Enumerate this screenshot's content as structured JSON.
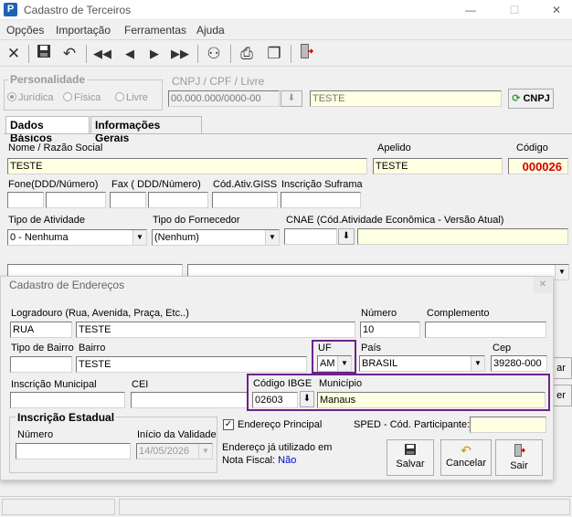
{
  "window": {
    "title": "Cadastro de Terceiros",
    "app_icon": "P",
    "minimize": "—",
    "maximize": "☐",
    "close": "✕"
  },
  "menu": [
    "Opções",
    "Importação",
    "Ferramentas",
    "Ajuda"
  ],
  "toolbar_icons": [
    "close-x-icon",
    "save-icon",
    "undo-icon",
    "first-record-icon",
    "previous-record-icon",
    "next-record-icon",
    "last-record-icon",
    "users-icon",
    "print-icon",
    "copy-icon",
    "exit-door-icon"
  ],
  "personalidade": {
    "title": "Personalidade",
    "options": [
      "Jurídica",
      "Física",
      "Livre"
    ],
    "selected": "Jurídica"
  },
  "cnpj": {
    "label": "CNPJ / CPF / Livre",
    "value": "00.000.000/0000-00",
    "name_value": "TESTE",
    "button": "CNPJ"
  },
  "tabs": [
    "Dados Básicos",
    "Informações Gerais"
  ],
  "basic": {
    "nome_label": "Nome / Razão Social",
    "nome_value": "TESTE",
    "apelido_label": "Apelido",
    "apelido_value": "TESTE",
    "codigo_label": "Código",
    "codigo_value": "000026",
    "fone_label": "Fone(DDD/Número)",
    "fax_label": "Fax ( DDD/Número)",
    "cod_ativ_label": "Cód.Ativ.GISS",
    "insc_suframa_label": "Inscrição Suframa",
    "tipo_atividade_label": "Tipo de Atividade",
    "tipo_atividade_value": "0 - Nenhuma",
    "tipo_fornecedor_label": "Tipo do Fornecedor",
    "tipo_fornecedor_value": "(Nenhum)",
    "cnae_label": "CNAE (Cód.Atividade Econômica - Versão Atual)"
  },
  "dialog": {
    "title": "Cadastro de Endereços",
    "close": "✕",
    "logradouro_label": "Logradouro (Rua, Avenida, Praça, Etc..)",
    "logradouro_tipo": "RUA",
    "logradouro_value": "TESTE",
    "numero_label": "Número",
    "numero_value": "10",
    "complemento_label": "Complemento",
    "tipo_bairro_label": "Tipo de Bairro",
    "bairro_label": "Bairro",
    "bairro_value": "TESTE",
    "uf_label": "UF",
    "uf_value": "AM",
    "pais_label": "País",
    "pais_value": "BRASIL",
    "cep_label": "Cep",
    "cep_value": "39280-000",
    "insc_municipal_label": "Inscrição Municipal",
    "cei_label": "CEI",
    "ibge_label": "Código IBGE",
    "ibge_value": "02603",
    "municipio_label": "Município",
    "municipio_value": "Manaus",
    "insc_estadual_title": "Inscrição Estadual",
    "ie_numero_label": "Número",
    "ie_inicio_label": "Início da Validade",
    "ie_inicio_value": "14/05/2026",
    "endereco_principal_label": "Endereço Principal",
    "endereco_principal_checked": true,
    "sped_label": "SPED - Cód. Participante:",
    "ja_utilizado_label": "Endereço já utilizado em Nota Fiscal:",
    "ja_utilizado_value": "Não",
    "btn_salvar": "Salvar",
    "btn_cancelar": "Cancelar",
    "btn_sair": "Sair"
  },
  "side_buttons": [
    "ar",
    "er"
  ],
  "colors": {
    "codigo": "#d40000",
    "highlight": "#6b2487",
    "yellow_field": "#ffffe1",
    "nao": "#0000cc"
  }
}
